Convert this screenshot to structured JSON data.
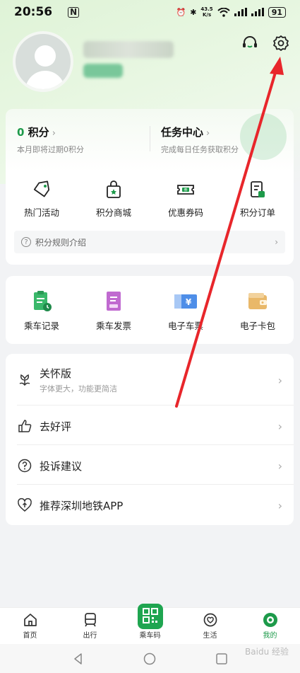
{
  "status_bar": {
    "time": "20:56",
    "n_badge": "N",
    "speed_top": "43.5",
    "speed_unit": "K/s",
    "battery": "91"
  },
  "points": {
    "count": "0",
    "label": "积分",
    "expire_note": "本月即将过期0积分",
    "task_title": "任务中心",
    "task_sub": "完成每日任务获取积分"
  },
  "quick_actions": [
    {
      "label": "热门活动",
      "icon": "tag-icon"
    },
    {
      "label": "积分商城",
      "icon": "shopping-bag-icon"
    },
    {
      "label": "优惠券码",
      "icon": "coupon-icon"
    },
    {
      "label": "积分订单",
      "icon": "order-icon"
    }
  ],
  "rules_label": "积分规则介绍",
  "ride_services": [
    {
      "label": "乘车记录",
      "icon": "ride-record-icon"
    },
    {
      "label": "乘车发票",
      "icon": "invoice-icon"
    },
    {
      "label": "电子车票",
      "icon": "e-ticket-icon"
    },
    {
      "label": "电子卡包",
      "icon": "card-wallet-icon"
    }
  ],
  "menu": [
    {
      "label": "关怀版",
      "sub": "字体更大，功能更简洁",
      "icon": "flower-icon"
    },
    {
      "label": "去好评",
      "sub": "",
      "icon": "thumbs-up-icon"
    },
    {
      "label": "投诉建议",
      "sub": "",
      "icon": "question-icon"
    },
    {
      "label": "推荐深圳地铁APP",
      "sub": "",
      "icon": "heart-share-icon"
    }
  ],
  "tabs": [
    {
      "label": "首页",
      "icon": "home-icon"
    },
    {
      "label": "出行",
      "icon": "train-icon"
    },
    {
      "label": "乘车码",
      "icon": "qr-code-icon"
    },
    {
      "label": "生活",
      "icon": "life-icon"
    },
    {
      "label": "我的",
      "icon": "profile-icon"
    }
  ],
  "watermark": "Baidu 经验",
  "colors": {
    "brand_green": "#1d9a4a",
    "arrow_red": "#e8262b"
  }
}
